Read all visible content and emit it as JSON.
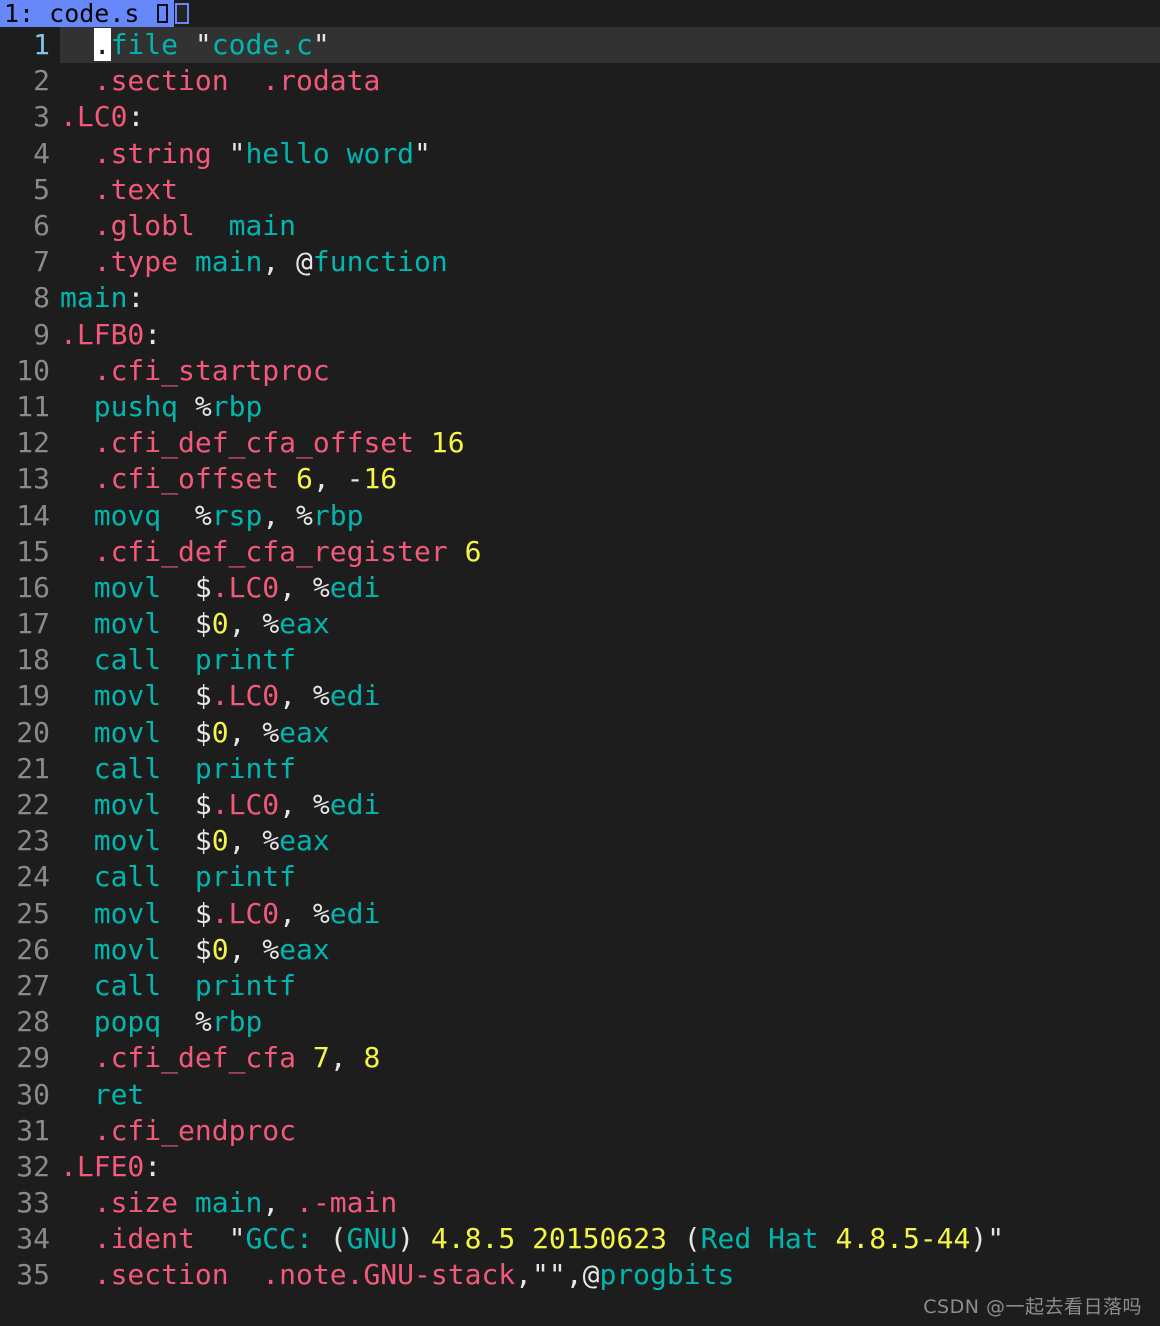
{
  "window": {
    "background_color": "#1d1d1d",
    "editor_font": "monospace"
  },
  "tabbar": {
    "active_tab_label": "1: code.s ",
    "active_tab_bg": "#6688f8",
    "active_tab_fg": "#050505",
    "icon_1": "missing-glyph-box",
    "icon_2": "missing-glyph-box-filled"
  },
  "editor": {
    "current_line": 1,
    "current_line_bg": "#323232",
    "gutter_fg": "#8a8a8a",
    "current_gutter_fg": "#7ec8ef",
    "cursor_char": ".",
    "colors": {
      "directive": "#f2597b",
      "identifier": "#00b6ae",
      "number": "#f5f545",
      "punctuation": "#e6e6e6",
      "string": "#00b6ae"
    },
    "lines": [
      {
        "n": "1",
        "text": ".file \"code.c\""
      },
      {
        "n": "2",
        "text": ".section  .rodata"
      },
      {
        "n": "3",
        "text": ".LC0:"
      },
      {
        "n": "4",
        "text": ".string \"hello word\""
      },
      {
        "n": "5",
        "text": ".text"
      },
      {
        "n": "6",
        "text": ".globl  main"
      },
      {
        "n": "7",
        "text": ".type main, @function"
      },
      {
        "n": "8",
        "text": "main:"
      },
      {
        "n": "9",
        "text": ".LFB0:"
      },
      {
        "n": "10",
        "text": ".cfi_startproc"
      },
      {
        "n": "11",
        "text": "pushq %rbp"
      },
      {
        "n": "12",
        "text": ".cfi_def_cfa_offset 16"
      },
      {
        "n": "13",
        "text": ".cfi_offset 6, -16"
      },
      {
        "n": "14",
        "text": "movq  %rsp, %rbp"
      },
      {
        "n": "15",
        "text": ".cfi_def_cfa_register 6"
      },
      {
        "n": "16",
        "text": "movl  $.LC0, %edi"
      },
      {
        "n": "17",
        "text": "movl  $0, %eax"
      },
      {
        "n": "18",
        "text": "call  printf"
      },
      {
        "n": "19",
        "text": "movl  $.LC0, %edi"
      },
      {
        "n": "20",
        "text": "movl  $0, %eax"
      },
      {
        "n": "21",
        "text": "call  printf"
      },
      {
        "n": "22",
        "text": "movl  $.LC0, %edi"
      },
      {
        "n": "23",
        "text": "movl  $0, %eax"
      },
      {
        "n": "24",
        "text": "call  printf"
      },
      {
        "n": "25",
        "text": "movl  $.LC0, %edi"
      },
      {
        "n": "26",
        "text": "movl  $0, %eax"
      },
      {
        "n": "27",
        "text": "call  printf"
      },
      {
        "n": "28",
        "text": "popq  %rbp"
      },
      {
        "n": "29",
        "text": ".cfi_def_cfa 7, 8"
      },
      {
        "n": "30",
        "text": "ret"
      },
      {
        "n": "31",
        "text": ".cfi_endproc"
      },
      {
        "n": "32",
        "text": ".LFE0:"
      },
      {
        "n": "33",
        "text": ".size main, .-main"
      },
      {
        "n": "34",
        "text": ".ident  \"GCC: (GNU) 4.8.5 20150623 (Red Hat 4.8.5-44)\""
      },
      {
        "n": "35",
        "text": ".section  .note.GNU-stack,\"\",@progbits"
      }
    ]
  },
  "watermark": {
    "text": "CSDN @一起去看日落吗"
  }
}
